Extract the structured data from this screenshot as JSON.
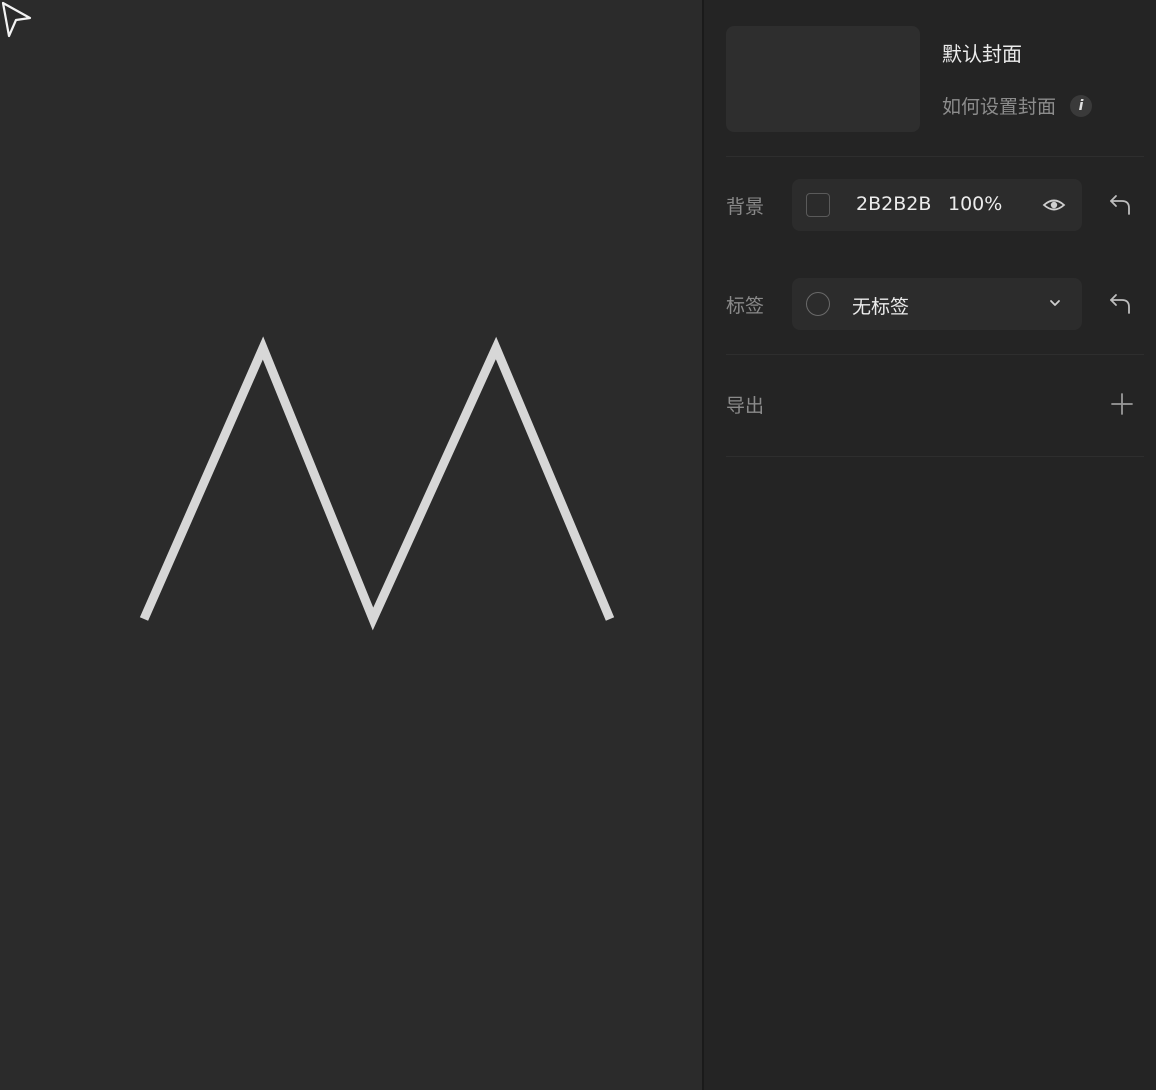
{
  "panel": {
    "cover": {
      "title": "默认封面",
      "help_text": "如何设置封面",
      "info_glyph": "i"
    },
    "background": {
      "label": "背景",
      "hex": "2B2B2B",
      "opacity": "100%",
      "color": "#2B2B2B"
    },
    "tag": {
      "label": "标签",
      "value": "无标签"
    },
    "export": {
      "label": "导出"
    }
  },
  "icons": [
    "cursor-icon",
    "info-icon",
    "color-swatch",
    "eye-icon",
    "undo-icon",
    "circle-icon",
    "chevron-down-icon",
    "plus-icon"
  ]
}
